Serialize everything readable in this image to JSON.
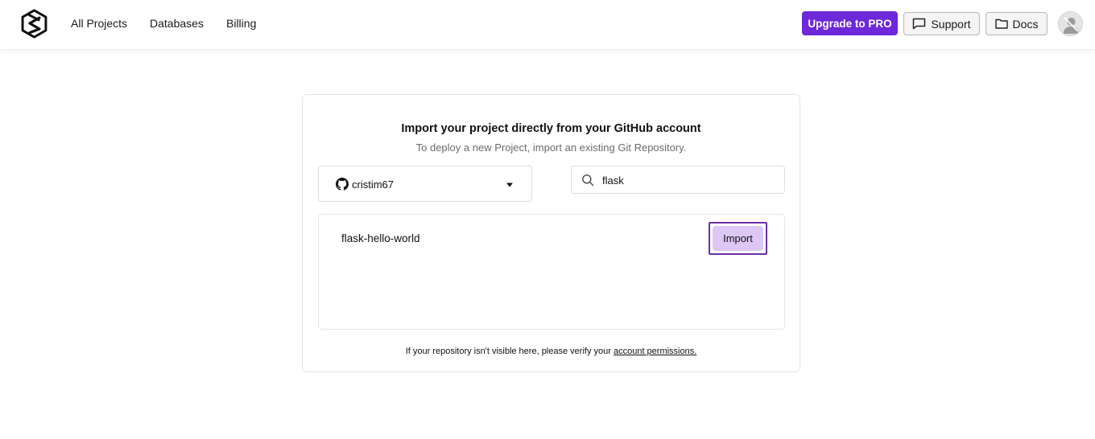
{
  "nav": {
    "items": [
      {
        "label": "All Projects"
      },
      {
        "label": "Databases"
      },
      {
        "label": "Billing"
      }
    ],
    "upgrade_label": "Upgrade to PRO",
    "support_label": "Support",
    "docs_label": "Docs"
  },
  "colors": {
    "brand_purple": "#6d28d9",
    "import_button_bg": "#dcc7f5",
    "focus_outline": "#6b2fa8"
  },
  "import_card": {
    "title": "Import your project directly from your GitHub account",
    "subtitle": "To deploy a new Project, import an existing Git Repository.",
    "account": {
      "icon": "github-icon",
      "name": "cristim67"
    },
    "search": {
      "icon": "search-icon",
      "value": "flask"
    },
    "repositories": [
      {
        "name": "flask-hello-world",
        "action_label": "Import"
      }
    ],
    "footer_text": "If your repository isn't visible here, please verify your",
    "footer_link": "account permissions."
  }
}
